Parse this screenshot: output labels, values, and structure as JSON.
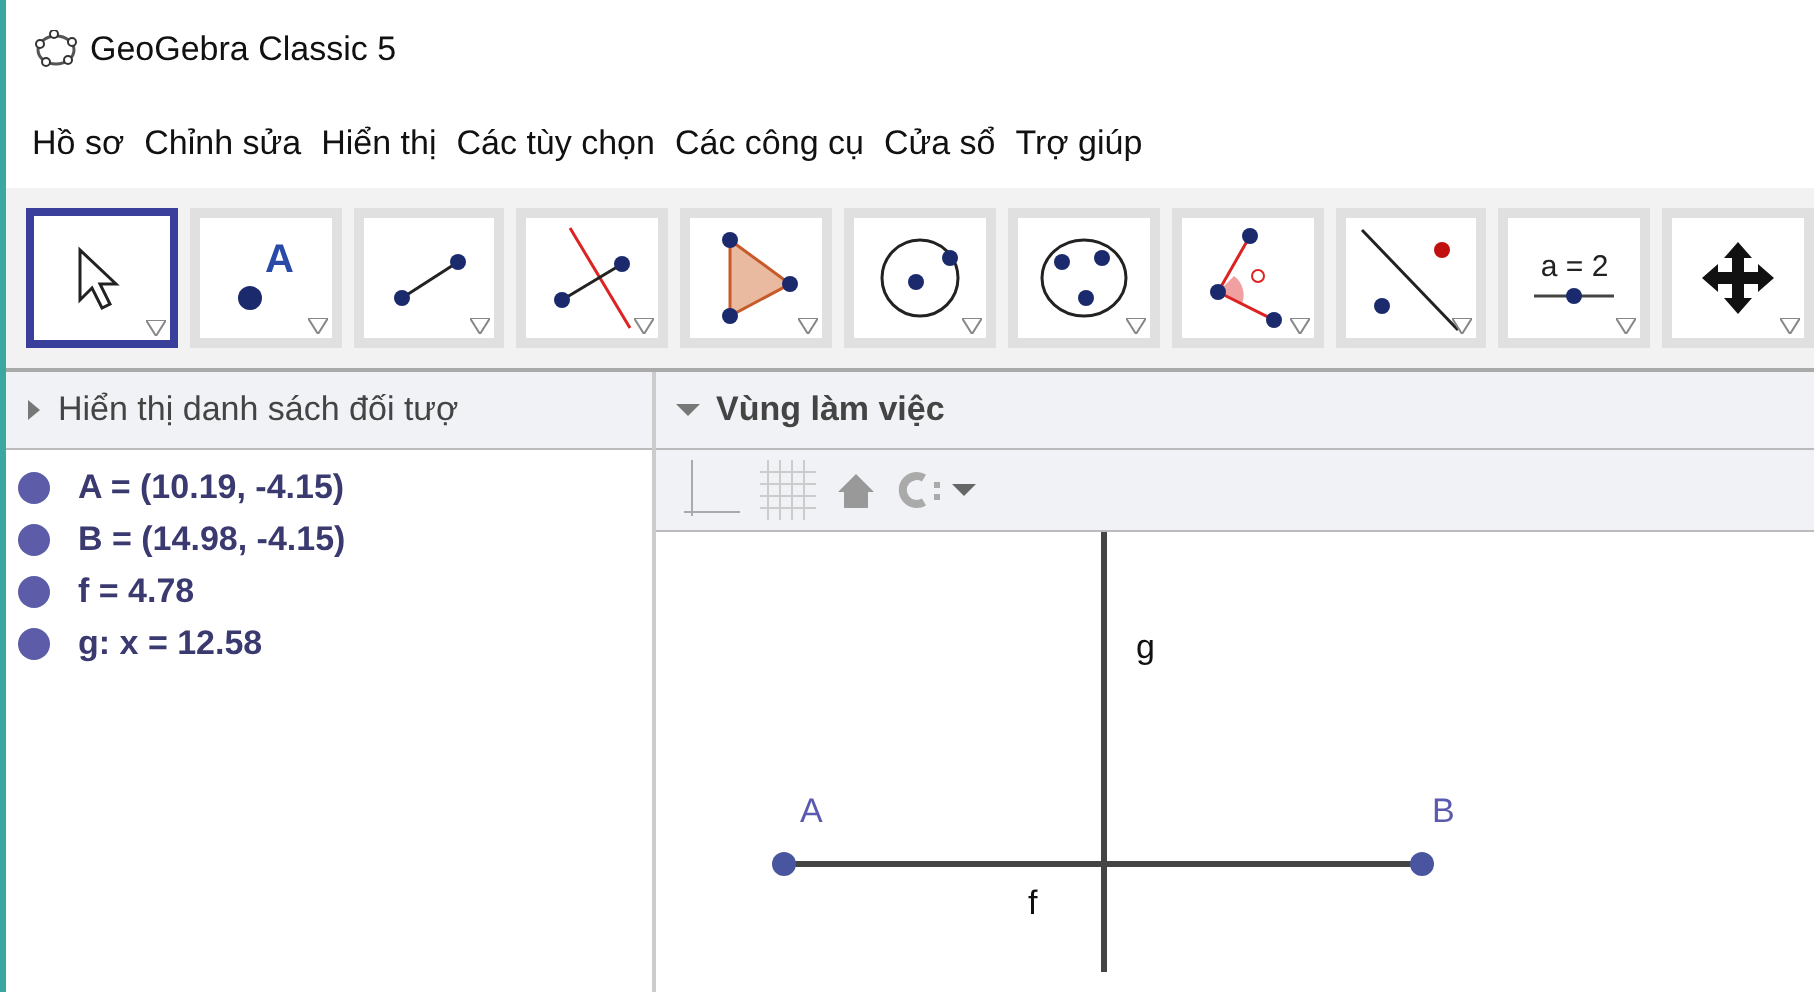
{
  "window": {
    "title": "GeoGebra Classic 5"
  },
  "menu": [
    "Hồ sơ",
    "Chỉnh sửa",
    "Hiển thị",
    "Các tùy chọn",
    "Các công cụ",
    "Cửa sổ",
    "Trợ giúp"
  ],
  "tools": [
    {
      "kind": "move",
      "selected": true
    },
    {
      "kind": "point",
      "selected": false,
      "label": "A"
    },
    {
      "kind": "segment",
      "selected": false
    },
    {
      "kind": "perpendicular",
      "selected": false
    },
    {
      "kind": "polygon",
      "selected": false
    },
    {
      "kind": "circle",
      "selected": false
    },
    {
      "kind": "circle3",
      "selected": false
    },
    {
      "kind": "angle",
      "selected": false
    },
    {
      "kind": "reflect",
      "selected": false
    },
    {
      "kind": "slider",
      "selected": false,
      "label": "a = 2"
    },
    {
      "kind": "pan",
      "selected": false
    }
  ],
  "algebra": {
    "title": "Hiển thị danh sách đối tượ",
    "expanded": false,
    "objects": [
      {
        "text": "A = (10.19, -4.15)",
        "color": "#5c5ca8"
      },
      {
        "text": "B = (14.98, -4.15)",
        "color": "#5c5ca8"
      },
      {
        "text": "f = 4.78",
        "color": "#5c5ca8"
      },
      {
        "text": "g: x = 12.58",
        "color": "#5c5ca8"
      }
    ]
  },
  "graphics": {
    "title": "Vùng làm việc",
    "expanded": true,
    "labels": {
      "g": "g",
      "f": "f",
      "A": "A",
      "B": "B"
    }
  }
}
